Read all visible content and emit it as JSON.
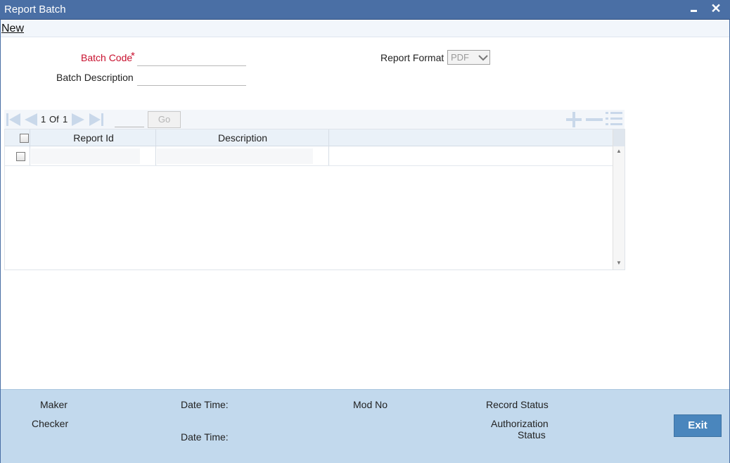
{
  "window": {
    "title": "Report Batch",
    "minimize_glyph": "▄",
    "close_glyph": "✕"
  },
  "menu": {
    "new_label": "New"
  },
  "form": {
    "batch_code_label": "Batch Code",
    "required_marker": "*",
    "batch_code_value": "",
    "batch_description_label": "Batch Description",
    "batch_description_value": "",
    "report_format_label": "Report Format",
    "report_format_value": "PDF",
    "report_format_options": [
      "PDF"
    ]
  },
  "grid": {
    "pager": {
      "current": "1",
      "of_label": "Of",
      "total": "1",
      "goto_value": "",
      "go_label": "Go"
    },
    "columns": [
      "Report Id",
      "Description"
    ],
    "rows": [
      {
        "report_id": "",
        "description": ""
      }
    ],
    "icons": [
      "first-page-icon",
      "previous-page-icon",
      "next-page-icon",
      "last-page-icon",
      "add-row-icon",
      "delete-row-icon",
      "view-rows-icon"
    ]
  },
  "footer": {
    "maker_label": "Maker",
    "checker_label": "Checker",
    "date_time_label_1": "Date Time:",
    "date_time_label_2": "Date Time:",
    "mod_no_label": "Mod No",
    "record_status_label": "Record Status",
    "authorization_label_line1": "Authorization",
    "authorization_label_line2": "Status",
    "exit_label": "Exit"
  },
  "colors": {
    "title_bar": "#4a6fa5",
    "required": "#c8102e",
    "footer": "#c2d9ed",
    "exit_button": "#4a86bd",
    "nav_icons": "#c9d8ea"
  }
}
